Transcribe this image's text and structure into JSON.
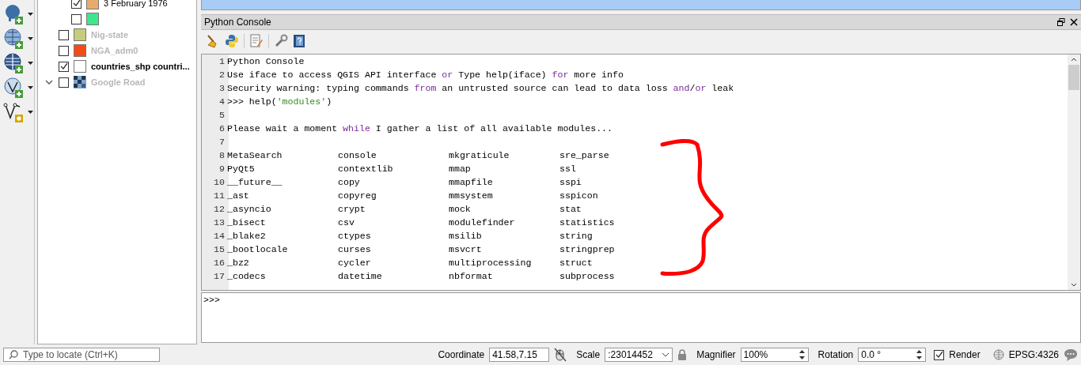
{
  "layer_tree": {
    "legend_items": [
      {
        "label": "3 February 1976",
        "checked": true,
        "color": "#e8ab6c"
      },
      {
        "checked": false,
        "color": "#3ee68c"
      }
    ],
    "layers": [
      {
        "label": "Nig-state",
        "kind": "vector",
        "checked": false,
        "disabled": true,
        "color": "#c6cc7c"
      },
      {
        "label": "NGA_adm0",
        "kind": "vector",
        "checked": false,
        "disabled": true,
        "color": "#f34c18"
      },
      {
        "label": "countries_shp countri...",
        "kind": "vector",
        "checked": true,
        "disabled": false,
        "color": "#ffffff"
      },
      {
        "label": "Google Road",
        "kind": "raster",
        "checked": false,
        "disabled": true,
        "expanded": true
      }
    ]
  },
  "console": {
    "title": "Python Console",
    "lines": [
      {
        "number": "1",
        "segments": [
          {
            "kind": "plain",
            "text": "Python Console"
          }
        ]
      },
      {
        "number": "2",
        "segments": [
          {
            "kind": "plain",
            "text": "Use iface to access QGIS API interface "
          },
          {
            "kind": "keyword",
            "text": "or"
          },
          {
            "kind": "plain",
            "text": " Type help(iface) "
          },
          {
            "kind": "keyword",
            "text": "for"
          },
          {
            "kind": "plain",
            "text": " more info"
          }
        ]
      },
      {
        "number": "3",
        "segments": [
          {
            "kind": "plain",
            "text": "Security warning: typing commands "
          },
          {
            "kind": "keyword",
            "text": "from"
          },
          {
            "kind": "plain",
            "text": " an untrusted source can lead to data loss "
          },
          {
            "kind": "keyword",
            "text": "and"
          },
          {
            "kind": "plain",
            "text": "/"
          },
          {
            "kind": "keyword",
            "text": "or"
          },
          {
            "kind": "plain",
            "text": " leak"
          }
        ]
      },
      {
        "number": "4",
        "segments": [
          {
            "kind": "plain",
            "text": ">>> help("
          },
          {
            "kind": "string",
            "text": "'modules'"
          },
          {
            "kind": "plain",
            "text": ")"
          }
        ]
      },
      {
        "number": "5"
      },
      {
        "number": "6",
        "segments": [
          {
            "kind": "plain",
            "text": "Please wait a moment "
          },
          {
            "kind": "keyword",
            "text": "while"
          },
          {
            "kind": "plain",
            "text": " I gather a list of all available modules..."
          }
        ]
      },
      {
        "number": "7"
      },
      {
        "number": "8",
        "modules": [
          "MetaSearch",
          "console",
          "mkgraticule",
          "sre_parse"
        ]
      },
      {
        "number": "9",
        "modules": [
          "PyQt5",
          "contextlib",
          "mmap",
          "ssl"
        ]
      },
      {
        "number": "10",
        "modules": [
          "__future__",
          "copy",
          "mmapfile",
          "sspi"
        ]
      },
      {
        "number": "11",
        "modules": [
          "_ast",
          "copyreg",
          "mmsystem",
          "sspicon"
        ]
      },
      {
        "number": "12",
        "modules": [
          "_asyncio",
          "crypt",
          "mock",
          "stat"
        ]
      },
      {
        "number": "13",
        "modules": [
          "_bisect",
          "csv",
          "modulefinder",
          "statistics"
        ]
      },
      {
        "number": "14",
        "modules": [
          "_blake2",
          "ctypes",
          "msilib",
          "string"
        ]
      },
      {
        "number": "15",
        "modules": [
          "_bootlocale",
          "curses",
          "msvcrt",
          "stringprep"
        ]
      },
      {
        "number": "16",
        "modules": [
          "_bz2",
          "cycler",
          "multiprocessing",
          "struct"
        ]
      },
      {
        "number": "17",
        "modules": [
          "_codecs",
          "datetime",
          "nbformat",
          "subprocess"
        ]
      }
    ],
    "prompt": ">>>"
  },
  "status_bar": {
    "locator": {
      "placeholder": "Type to locate (Ctrl+K)"
    },
    "coordinate_label": "Coordinate",
    "coordinate": "41.58,7.15",
    "scale_label": "Scale",
    "scale": ":23014452",
    "magnifier_label": "Magnifier",
    "magnifier": "100%",
    "rotation_label": "Rotation",
    "rotation": "0.0 °",
    "render": {
      "label": "Render",
      "checked": true
    },
    "crs": "EPSG:4326"
  }
}
